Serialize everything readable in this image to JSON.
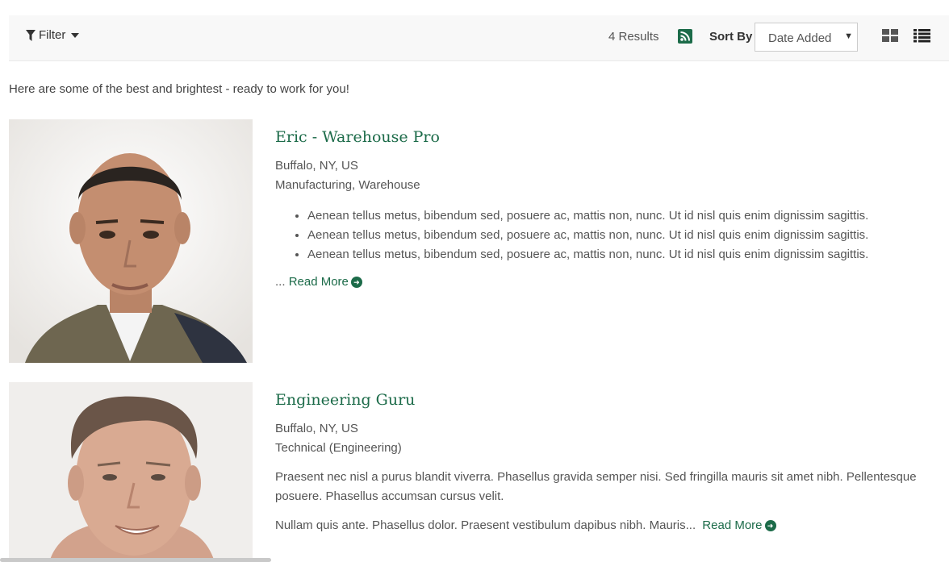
{
  "toolbar": {
    "filter_label": "Filter",
    "results": "4 Results",
    "sort_label": "Sort By",
    "sort_value": "Date Added",
    "accent": "#1c6b49"
  },
  "intro": "Here are some of the best and brightest - ready to work for you!",
  "listings": [
    {
      "name": "Eric - Warehouse Pro",
      "location": "Buffalo, NY, US",
      "category": "Manufacturing, Warehouse",
      "bullets": [
        "Aenean tellus metus, bibendum sed, posuere ac, mattis non, nunc. Ut id nisl quis enim dignissim sagittis.",
        "Aenean tellus metus, bibendum sed, posuere ac, mattis non, nunc. Ut id nisl quis enim dignissim sagittis.",
        "Aenean tellus metus, bibendum sed, posuere ac, mattis non, nunc. Ut id nisl quis enim dignissim sagittis."
      ],
      "ellipsis": "...",
      "read_more": "Read More"
    },
    {
      "name": "Engineering Guru",
      "location": "Buffalo, NY, US",
      "category": "Technical (Engineering)",
      "paragraph": "Praesent nec nisl a purus blandit viverra. Phasellus gravida semper nisi. Sed fringilla mauris sit amet nibh. Pellentesque posuere. Phasellus accumsan cursus velit.",
      "teaser": "Nullam quis ante. Phasellus dolor. Praesent vestibulum dapibus nibh. Mauris...",
      "read_more": "Read More"
    }
  ],
  "icons": [
    "filter-icon",
    "rss-icon",
    "grid-view-icon",
    "list-view-icon",
    "arrow-circle-right-icon"
  ]
}
